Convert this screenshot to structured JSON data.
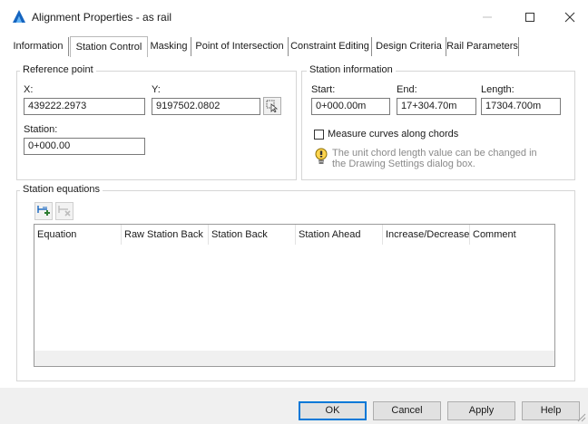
{
  "window": {
    "title": "Alignment Properties - as rail",
    "accent": "#1565c0"
  },
  "tabs": [
    {
      "label": "Information"
    },
    {
      "label": "Station Control",
      "active": true
    },
    {
      "label": "Masking"
    },
    {
      "label": "Point of Intersection"
    },
    {
      "label": "Constraint Editing"
    },
    {
      "label": "Design Criteria"
    },
    {
      "label": "Rail Parameters"
    }
  ],
  "reference_point": {
    "group_label": "Reference point",
    "x_label": "X:",
    "x_value": "439222.2973",
    "y_label": "Y:",
    "y_value": "9197502.0802",
    "station_label": "Station:",
    "station_value": "0+000.00"
  },
  "station_information": {
    "group_label": "Station information",
    "start_label": "Start:",
    "start_value": "0+000.00m",
    "end_label": "End:",
    "end_value": "17+304.70m",
    "length_label": "Length:",
    "length_value": "17304.700m",
    "measure_label": "Measure curves along chords",
    "measure_checked": false,
    "note": "The unit chord length value can be changed in the Drawing Settings dialog box."
  },
  "station_equations": {
    "group_label": "Station equations",
    "columns": [
      "Equation",
      "Raw Station Back",
      "Station Back",
      "Station Ahead",
      "Increase/Decrease",
      "Comment"
    ],
    "rows": []
  },
  "buttons": {
    "ok": "OK",
    "cancel": "Cancel",
    "apply": "Apply",
    "help": "Help"
  }
}
